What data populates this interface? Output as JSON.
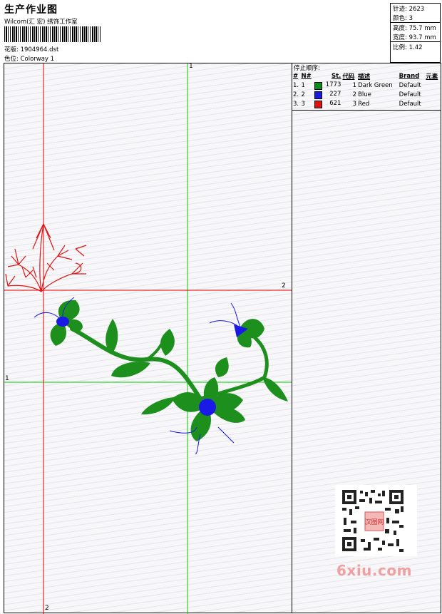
{
  "header": {
    "title": "生产作业图",
    "studio": "Wilcom(汇 宏) 绣饰工作室",
    "design_label": "花版:",
    "design_file": "1904964.dst",
    "colorway_label": "色位:",
    "colorway": "Colorway 1"
  },
  "stats": {
    "stitches_label": "针迹:",
    "stitches": "2623",
    "colors_label": "颜色:",
    "colors": "3",
    "height_label": "高度:",
    "height": "75.7 mm",
    "width_label": "宽度:",
    "width": "93.7 mm",
    "scale_label": "比例:",
    "scale": "1.42"
  },
  "stop_sequence": {
    "title": "停止顺序:",
    "columns": [
      "#",
      "N#",
      "St.",
      "代码",
      "描述",
      "Brand",
      "元素"
    ],
    "rows": [
      {
        "num": "1.",
        "n": "1",
        "stitches": "1773",
        "code": "1",
        "description": "Dark Green",
        "brand": "Default",
        "color": "#0f8a1c"
      },
      {
        "num": "2.",
        "n": "2",
        "stitches": "227",
        "code": "2",
        "description": "Blue",
        "brand": "Default",
        "color": "#1919e0"
      },
      {
        "num": "3.",
        "n": "3",
        "stitches": "621",
        "code": "3",
        "description": "Red",
        "brand": "Default",
        "color": "#e01010"
      }
    ]
  },
  "guides": {
    "vertical_top": "1",
    "horizontal_right": "2",
    "horizontal_left": "1",
    "vertical_bottom": "2"
  },
  "colors": {
    "green_guide": "#00d000",
    "red_guide": "#e00000",
    "thread_green": "#1d8f1d",
    "thread_blue": "#1a1ae6",
    "thread_red": "#e01414"
  },
  "watermark": {
    "text": "6xiu.com",
    "seal": "汉图网"
  }
}
